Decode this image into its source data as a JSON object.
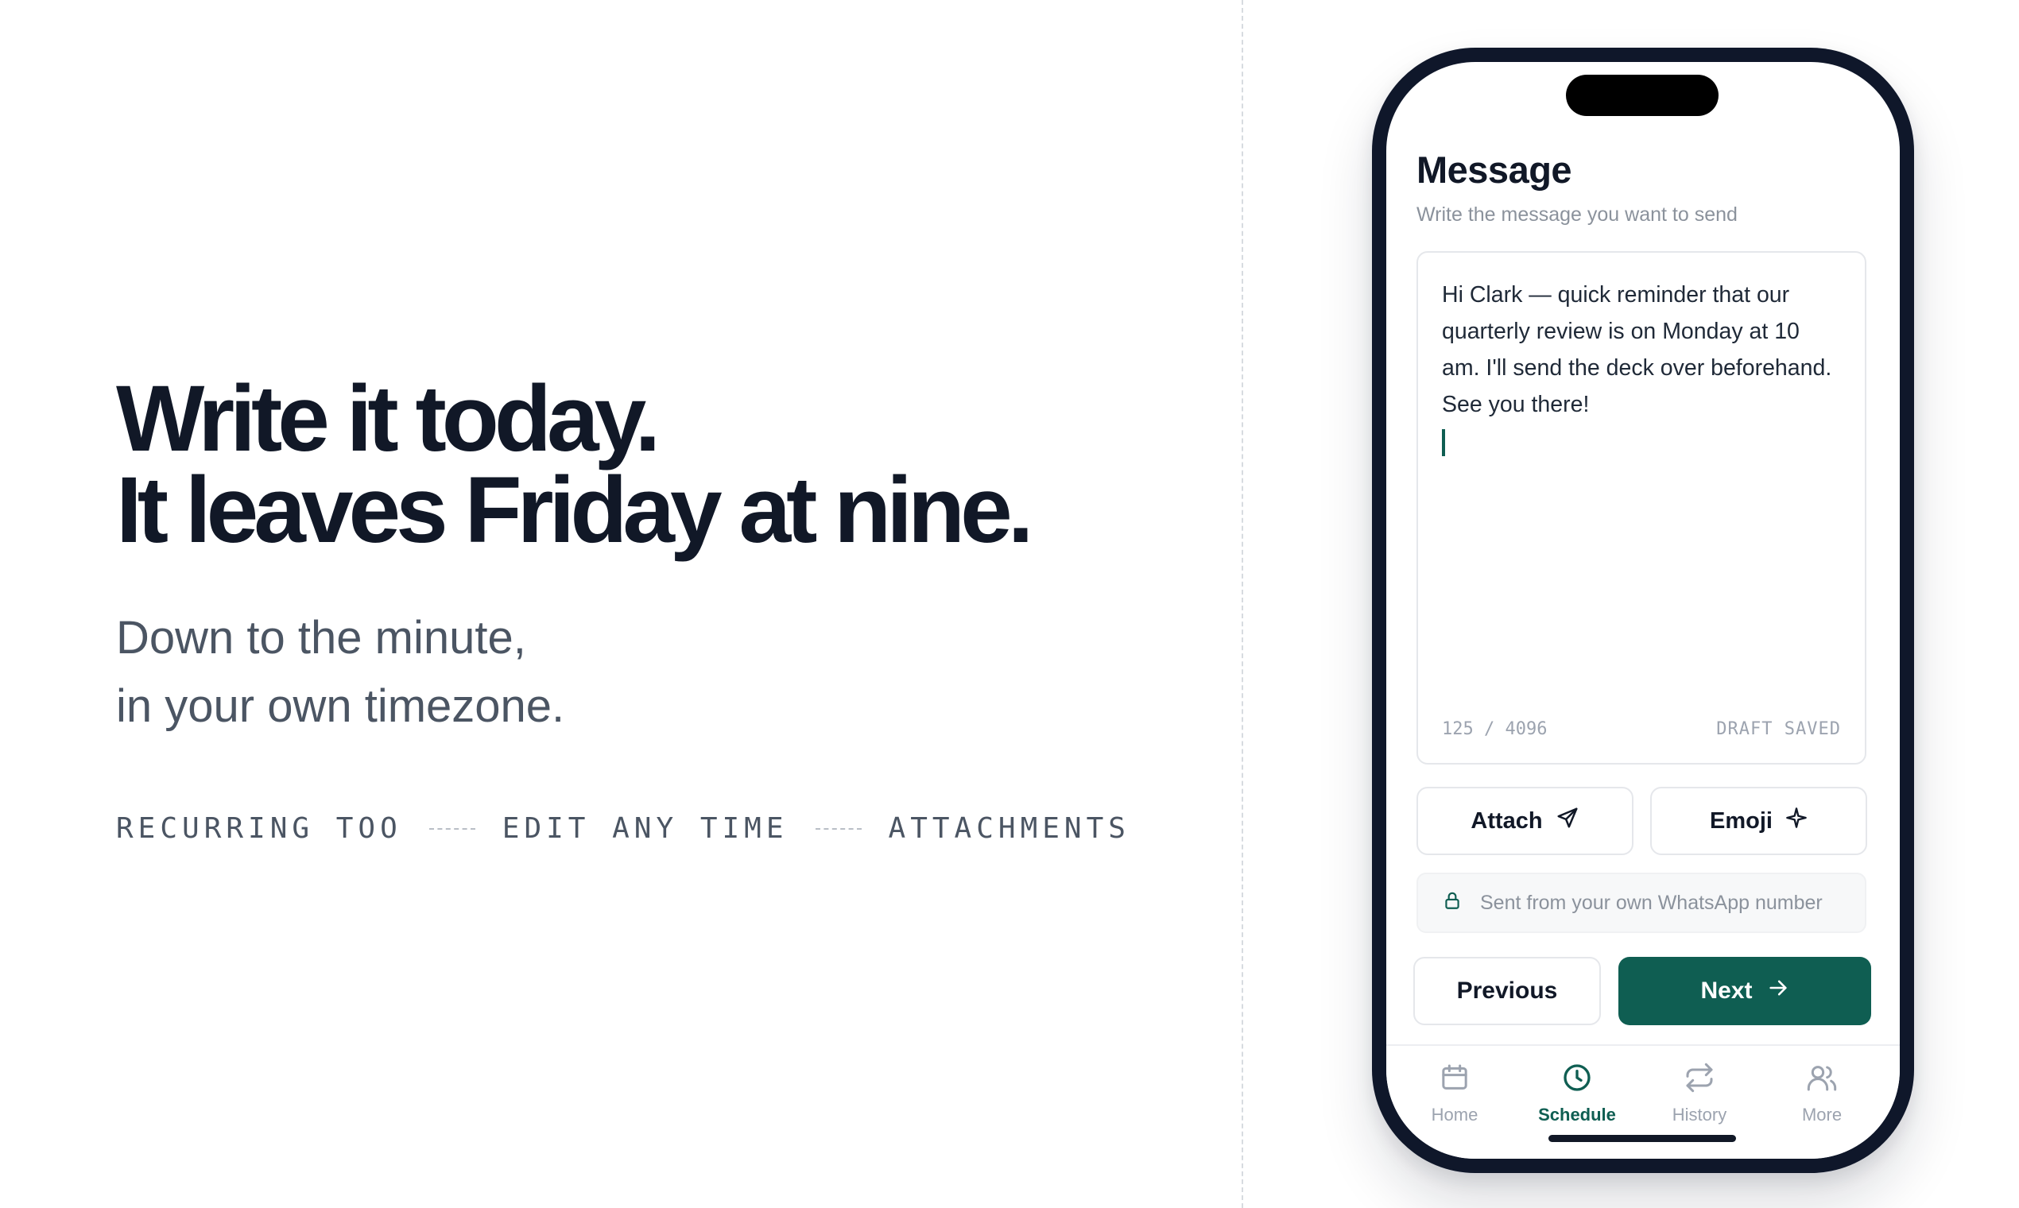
{
  "hero": {
    "headline_line1": "Write it today.",
    "headline_line2": "It leaves Friday at nine.",
    "sub_line1": "Down to the minute,",
    "sub_line2": "in your own timezone.",
    "features": [
      "RECURRING TOO",
      "EDIT ANY TIME",
      "ATTACHMENTS"
    ]
  },
  "composer": {
    "title": "Message",
    "subtitle": "Write the message you want to send",
    "body": "Hi Clark — quick reminder that our quarterly review is on Monday at 10 am. I'll send the deck over beforehand. See you there!",
    "counter": "125 / 4096",
    "status": "DRAFT SAVED",
    "attach_label": "Attach",
    "emoji_label": "Emoji",
    "notice": "Sent from your own WhatsApp number",
    "previous_label": "Previous",
    "next_label": "Next"
  },
  "tabs": [
    {
      "label": "Home",
      "icon": "calendar-icon",
      "active": false
    },
    {
      "label": "Schedule",
      "icon": "clock-icon",
      "active": true
    },
    {
      "label": "History",
      "icon": "repeat-icon",
      "active": false
    },
    {
      "label": "More",
      "icon": "users-icon",
      "active": false
    }
  ],
  "colors": {
    "accent": "#0f5e52",
    "heading": "#111827",
    "muted": "#9ca3af",
    "phone_frame": "#0f172a"
  }
}
